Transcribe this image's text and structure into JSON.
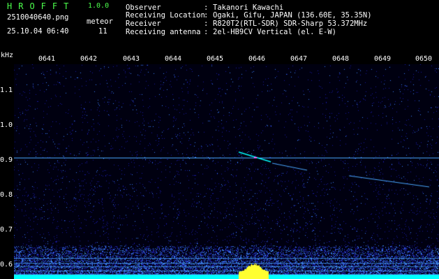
{
  "header": {
    "app_name": "HROFFT",
    "app_version": "1.0.0",
    "file_name": "2510040640.png",
    "datetime": "25.10.04 06:40",
    "count_label": "meteor",
    "count_value": "11",
    "info": [
      {
        "label": "Observer",
        "value": "Takanori Kawachi"
      },
      {
        "label": "Receiving Location",
        "value": "Ogaki, Gifu, JAPAN (136.60E, 35.35N)"
      },
      {
        "label": "Receiver",
        "value": "R820T2(RTL-SDR) SDR-Sharp 53.372MHz"
      },
      {
        "label": "Receiving antenna",
        "value": "2el-HB9CV Vertical (el. E-W)"
      }
    ],
    "separator": ":"
  },
  "spectrogram": {
    "unit_label": "kHz",
    "time_ticks": [
      "0641",
      "0642",
      "0643",
      "0644",
      "0645",
      "0646",
      "0647",
      "0648",
      "0649",
      "0650"
    ],
    "freq_ticks": [
      "1.1",
      "1.0",
      "0.9",
      "0.8",
      "0.7",
      "0.6"
    ],
    "colors": {
      "background": "#000010",
      "noise_dim": "#1a1aa0",
      "noise_bright": "#3a7cff",
      "carrier": "#4aa8ff",
      "hot": "#00ffff",
      "peak": "#ffff30",
      "label": "#4cff4c"
    }
  }
}
